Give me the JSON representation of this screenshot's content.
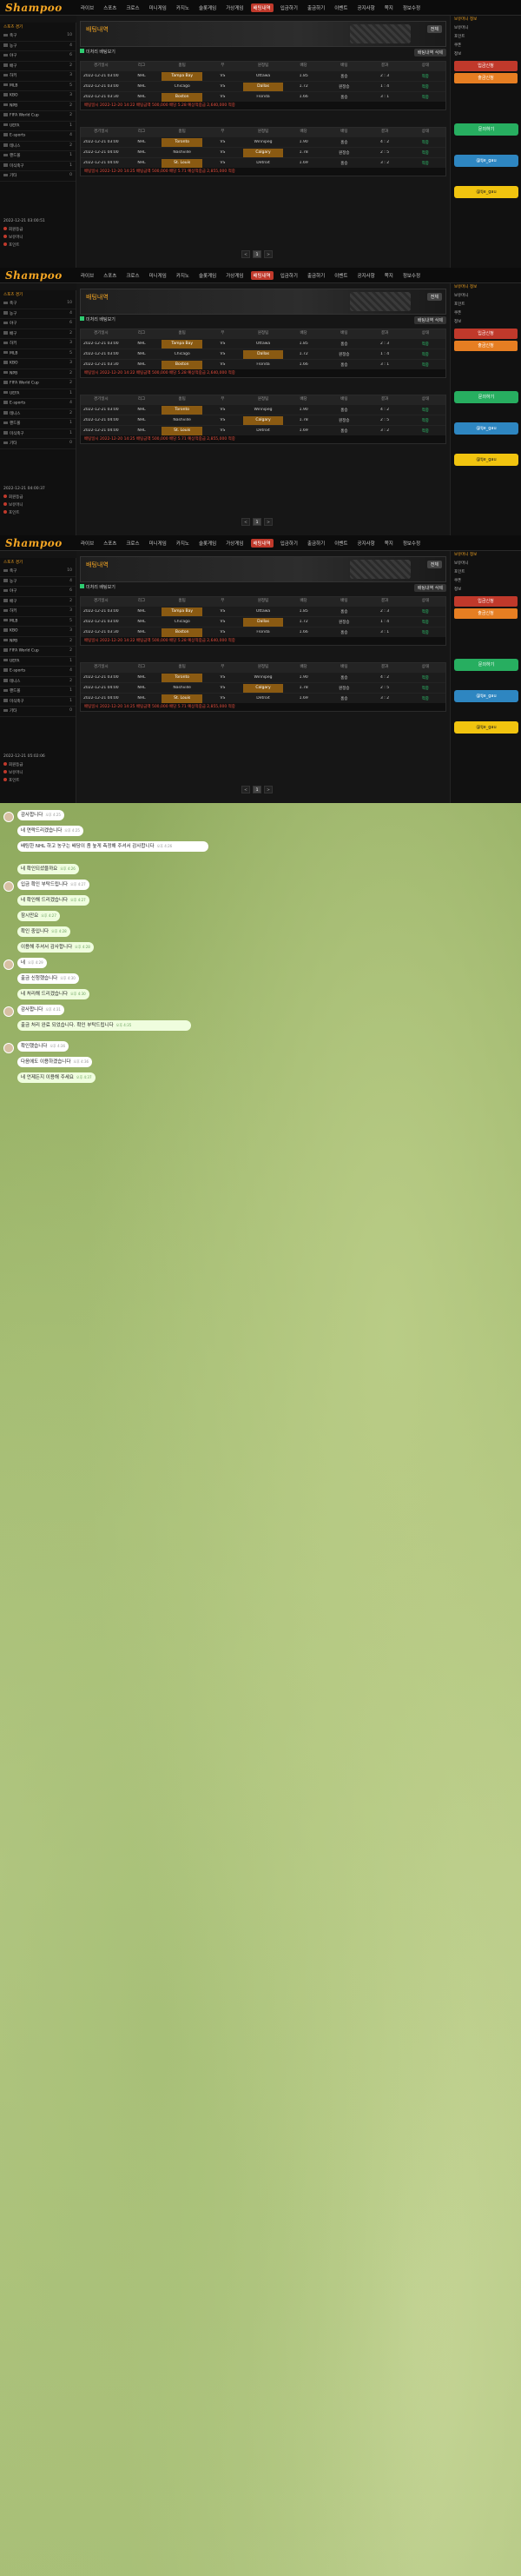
{
  "site": {
    "logo": "Shampoo",
    "nav": [
      "라이브",
      "스포츠",
      "크로스",
      "미니게임",
      "카지노",
      "슬롯게임",
      "가상게임",
      "배팅내역",
      "입금하기",
      "출금하기",
      "이벤트",
      "공지사항",
      "쪽지",
      "정보수정"
    ],
    "active_nav": 7,
    "left_title": "스포츠 경기",
    "left_items": [
      {
        "label": "축구",
        "count": "10"
      },
      {
        "label": "농구",
        "count": "4"
      },
      {
        "label": "야구",
        "count": "6"
      },
      {
        "label": "배구",
        "count": "2"
      },
      {
        "label": "하키",
        "count": "3"
      },
      {
        "label": "MLB",
        "count": "5"
      },
      {
        "label": "KBO",
        "count": "3"
      },
      {
        "label": "NPB",
        "count": "2"
      },
      {
        "label": "FIFA World Cup",
        "count": "2"
      },
      {
        "label": "UEFA",
        "count": "1"
      },
      {
        "label": "E-sports",
        "count": "4"
      },
      {
        "label": "테니스",
        "count": "2"
      },
      {
        "label": "핸드볼",
        "count": "1"
      },
      {
        "label": "미식축구",
        "count": "1"
      },
      {
        "label": "기타",
        "count": "0"
      }
    ],
    "left_foot": [
      "회원등급",
      "보유머니",
      "포인트"
    ],
    "banner_title": "배팅내역",
    "banner_button": "전체",
    "filter_label": "미처리 배팅보기",
    "filter_button": "배팅내역 삭제",
    "table_head": [
      "경기일시",
      "리그",
      "홈팀",
      "무",
      "원정팀",
      "배당",
      "배팅",
      "결과",
      "상태"
    ],
    "blocks": [
      {
        "rows": [
          {
            "date": "2022-12-21 03:00",
            "league": "NHL",
            "home": "Tampa Bay",
            "draw": "VS",
            "away": "Ottawa",
            "odds": "1.85",
            "bet": "홈승",
            "result": "2 : 3",
            "state": "적중"
          },
          {
            "date": "2022-12-21 03:00",
            "league": "NHL",
            "home": "Chicago",
            "draw": "VS",
            "away": "Dallas",
            "odds": "1.72",
            "bet": "원정승",
            "result": "1 : 4",
            "state": "적중"
          },
          {
            "date": "2022-12-21 03:30",
            "league": "NHL",
            "home": "Boston",
            "draw": "VS",
            "away": "Florida",
            "odds": "1.66",
            "bet": "홈승",
            "result": "3 : 1",
            "state": "적중"
          }
        ],
        "summary": "배팅일시 2022-12-20 14:22  배팅금액 500,000  배당 5.28  예상적중금 2,640,000  적중"
      },
      {
        "rows": [
          {
            "date": "2022-12-21 03:00",
            "league": "NHL",
            "home": "Toronto",
            "draw": "VS",
            "away": "Winnipeg",
            "odds": "1.90",
            "bet": "홈승",
            "result": "4 : 2",
            "state": "적중"
          },
          {
            "date": "2022-12-21 04:00",
            "league": "NHL",
            "home": "Nashville",
            "draw": "VS",
            "away": "Calgary",
            "odds": "1.78",
            "bet": "원정승",
            "result": "2 : 5",
            "state": "적중"
          },
          {
            "date": "2022-12-21 04:00",
            "league": "NHL",
            "home": "St. Louis",
            "draw": "VS",
            "away": "Detroit",
            "odds": "1.69",
            "bet": "홈승",
            "result": "3 : 2",
            "state": "적중"
          }
        ],
        "summary": "배팅일시 2022-12-20 14:25  배팅금액 500,000  배당 5.71  예상적중금 2,855,000  적중"
      }
    ],
    "pager": [
      "<",
      "1",
      ">"
    ],
    "right_head": "보유머니 정보",
    "right_rows": [
      "보유머니",
      "포인트",
      "쿠폰",
      "정보"
    ],
    "right_buttons": [
      "입금신청",
      "출금신청"
    ],
    "circles": [
      {
        "label": "문의하기",
        "color": "#27ae60"
      },
      {
        "label": "@tje_gau",
        "color": "#2e86c1"
      },
      {
        "label": "@tje_gau",
        "color": "#f1c40f"
      }
    ]
  },
  "panel_times": [
    "2022-12-21 03:00:51",
    "2022-12-21 04:00:37",
    "2022-12-21 05:02:06"
  ],
  "chat": {
    "messages": [
      {
        "text": "감사합니다",
        "time": "오후 4:25",
        "side": "in"
      },
      {
        "text": "네 연락드리겠습니다",
        "time": "오후 4:25",
        "side": "in"
      },
      {
        "text": "배팅한 NHL 하고 농구는 배당이 좀 높게 측정해 주셔서 감사합니다",
        "time": "오후 4:26",
        "side": "in"
      },
      {
        "text": "네 확인되셨을까요",
        "time": "오후 4:26",
        "side": "out"
      },
      {
        "text": "입금 확인 부탁드립니다",
        "time": "오후 4:27",
        "side": "in"
      },
      {
        "text": "네 확인해 드리겠습니다",
        "time": "오후 4:27",
        "side": "out"
      },
      {
        "text": "잠시만요",
        "time": "오후 4:27",
        "side": "out"
      },
      {
        "text": "확인 중입니다",
        "time": "오후 4:28",
        "side": "out"
      },
      {
        "text": "이용해 주셔서 감사합니다",
        "time": "오후 4:28",
        "side": "out"
      },
      {
        "text": "네",
        "time": "오후 4:29",
        "side": "in"
      },
      {
        "text": "출금 신청했습니다",
        "time": "오후 4:30",
        "side": "in"
      },
      {
        "text": "네 처리해 드리겠습니다",
        "time": "오후 4:30",
        "side": "out"
      },
      {
        "text": "감사합니다",
        "time": "오후 4:31",
        "side": "in"
      },
      {
        "text": "출금 처리 완료 되었습니다. 확인 부탁드립니다",
        "time": "오후 4:35",
        "side": "out"
      },
      {
        "text": "확인했습니다",
        "time": "오후 4:36",
        "side": "in"
      },
      {
        "text": "다음에도 이용하겠습니다",
        "time": "오후 4:36",
        "side": "in"
      },
      {
        "text": "네 언제든지 이용해 주세요",
        "time": "오후 4:37",
        "side": "out"
      }
    ]
  }
}
